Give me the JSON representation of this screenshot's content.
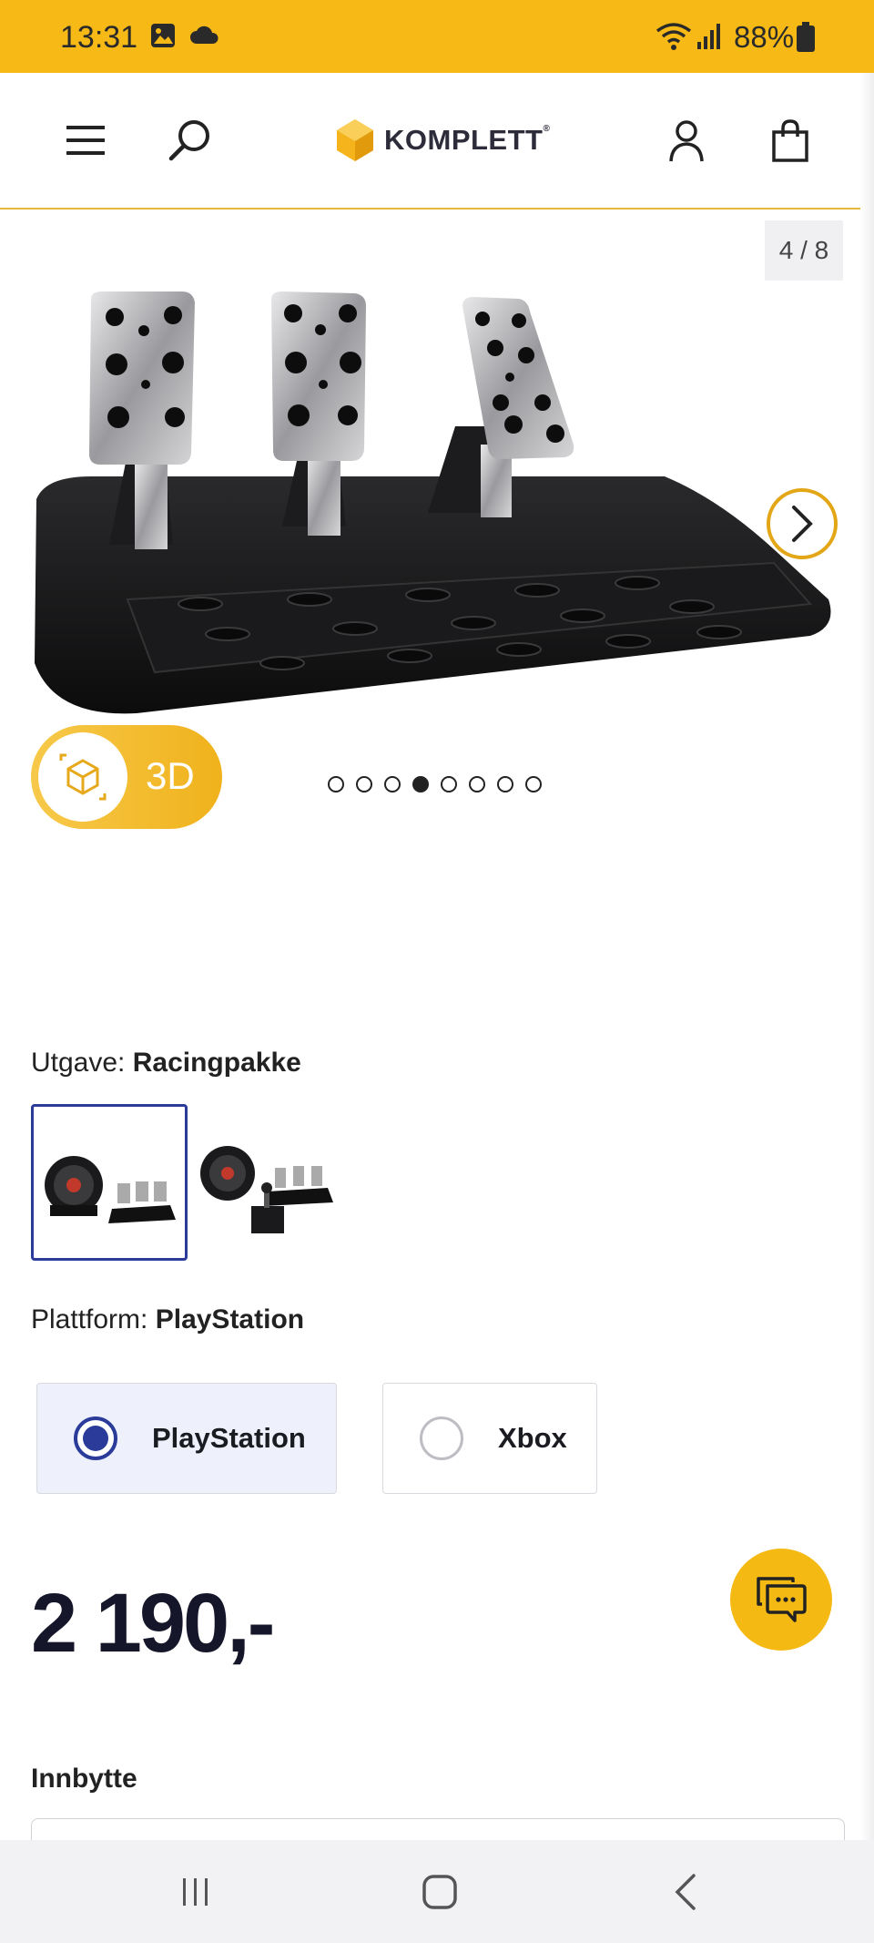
{
  "status_bar": {
    "time": "13:31",
    "battery": "88%",
    "icons": [
      "image-icon",
      "cloud-icon",
      "wifi-icon",
      "signal-icon",
      "battery-icon"
    ]
  },
  "header": {
    "logo_text": "KOMPLETT",
    "logo_mark": "®",
    "icons": [
      "menu-icon",
      "search-icon",
      "user-icon",
      "cart-icon"
    ]
  },
  "gallery": {
    "counter": "4 / 8",
    "btn_3d": "3D",
    "current_index": 4,
    "total": 8
  },
  "edition": {
    "prefix": "Utgave:",
    "value": "Racingpakke",
    "selected_index": 0
  },
  "platform": {
    "prefix": "Plattform:",
    "value": "PlayStation",
    "options": [
      "PlayStation",
      "Xbox"
    ],
    "selected": "PlayStation"
  },
  "price": "2 190,-",
  "trade_in": {
    "label": "Innbytte"
  },
  "colors": {
    "brand_yellow": "#f7b916",
    "selection_blue": "#2a3b9a",
    "price_text": "#16162a"
  }
}
